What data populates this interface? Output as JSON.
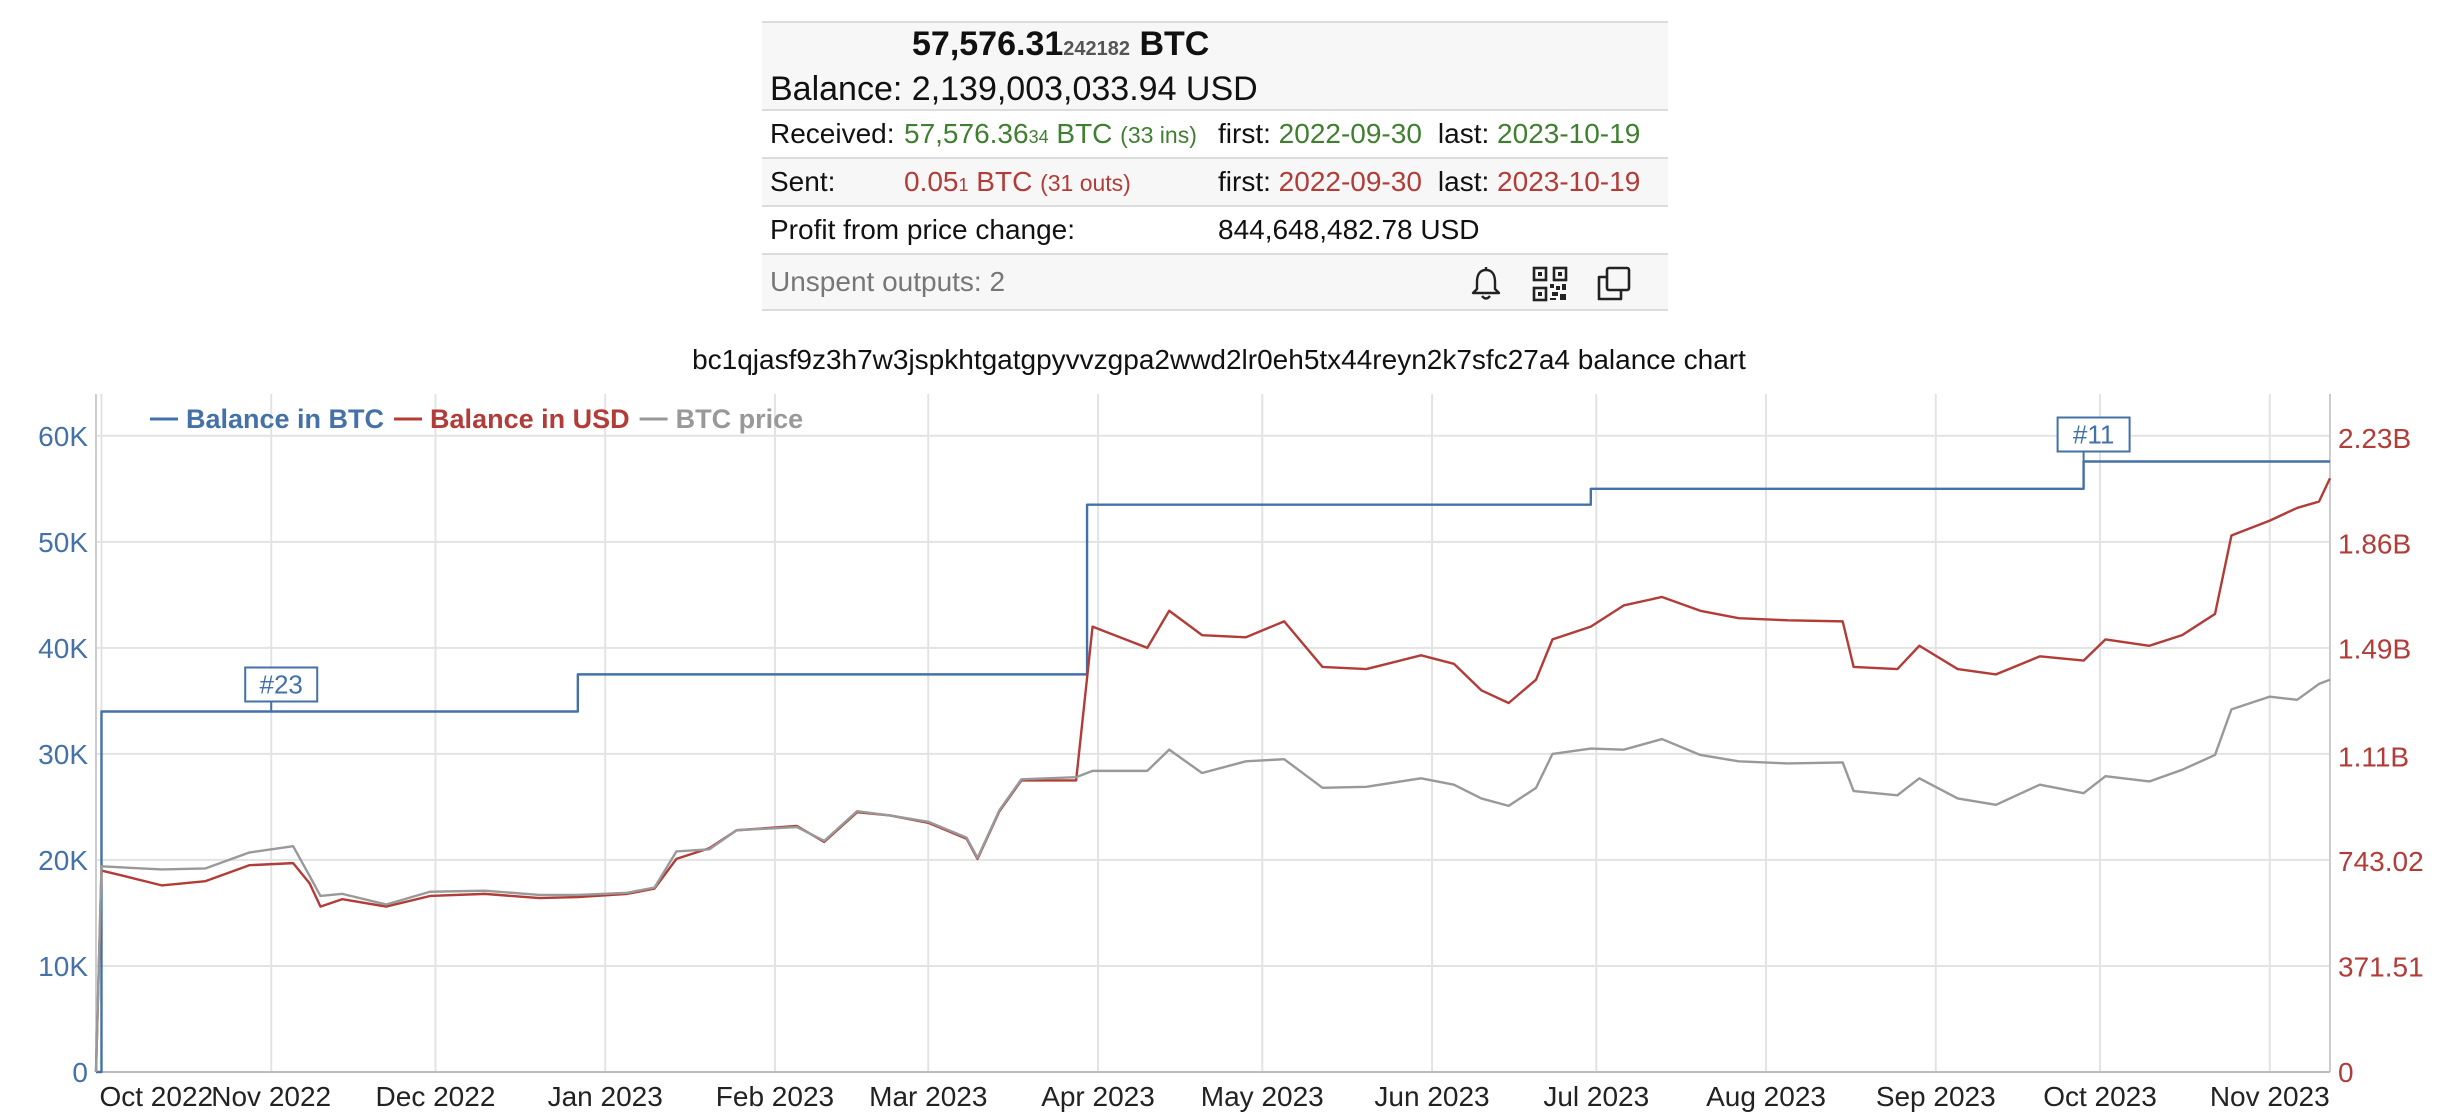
{
  "summary": {
    "btc_int": "57,576.31",
    "btc_frac": "242182",
    "btc_unit": "BTC",
    "balance_label": "Balance:",
    "balance_usd": "2,139,003,033.94 USD",
    "received": {
      "label": "Received:",
      "amount_main": "57,576.36",
      "amount_frac": "34",
      "unit": " BTC",
      "count": "(33 ins)",
      "first_label": "first:",
      "first": "2022-09-30",
      "last_label": "last:",
      "last": "2023-10-19"
    },
    "sent": {
      "label": "Sent:",
      "amount_main": "0.05",
      "amount_frac": "1",
      "unit": " BTC",
      "count": "(31 outs)",
      "first_label": "first:",
      "first": "2022-09-30",
      "last_label": "last:",
      "last": "2023-10-19"
    },
    "profit": {
      "label": "Profit from price change:",
      "value": "844,648,482.78 USD"
    },
    "unspent": "Unspent outputs: 2",
    "icons": [
      "bell-icon",
      "qr-code-icon",
      "copy-icon"
    ]
  },
  "chart_title": "bc1qjasf9z3h7w3jspkhtgatgpyvvzgpa2wwd2lr0eh5tx44reyn2k7sfc27a4 balance chart",
  "colors": {
    "btc": "#4471a8",
    "usd": "#b23c37",
    "price": "#999999",
    "grid": "#e3e3e3"
  },
  "chart_data": {
    "type": "line",
    "x_range": [
      "2022-09-30",
      "2023-11-12"
    ],
    "y_left": {
      "range": [
        0,
        63000
      ],
      "ticks": [
        0,
        10000,
        20000,
        30000,
        40000,
        50000,
        60000
      ],
      "tick_labels": [
        "0",
        "10K",
        "20K",
        "30K",
        "40K",
        "50K",
        "60K"
      ]
    },
    "y_right": {
      "range": [
        0,
        2350000000
      ],
      "ticks": [
        0,
        371510000,
        743020000,
        1110000000,
        1490000000,
        1860000000,
        2230000000
      ],
      "tick_labels": [
        "0",
        "371.51",
        "743.02",
        "1.11B",
        "1.49B",
        "1.86B",
        "2.23B"
      ]
    },
    "x_ticks": [
      "2022-10-01",
      "2022-11-01",
      "2022-12-01",
      "2023-01-01",
      "2023-02-01",
      "2023-03-01",
      "2023-04-01",
      "2023-05-01",
      "2023-06-01",
      "2023-07-01",
      "2023-08-01",
      "2023-09-01",
      "2023-10-01",
      "2023-11-01"
    ],
    "x_tick_labels": [
      "Oct 2022",
      "Nov 2022",
      "Dec 2022",
      "Jan 2023",
      "Feb 2023",
      "Mar 2023",
      "Apr 2023",
      "May 2023",
      "Jun 2023",
      "Jul 2023",
      "Aug 2023",
      "Sep 2023",
      "Oct 2023",
      "Nov 2023"
    ],
    "legend": [
      "Balance in BTC",
      "Balance in USD",
      "BTC price"
    ],
    "legend_position": "top-left",
    "grid": true,
    "series": [
      {
        "name": "Balance in BTC",
        "axis": "left",
        "step": true,
        "points": [
          [
            "2022-09-30",
            0
          ],
          [
            "2022-10-01",
            34000
          ],
          [
            "2022-12-27",
            37500
          ],
          [
            "2023-03-30",
            53500
          ],
          [
            "2023-06-30",
            55000
          ],
          [
            "2023-09-28",
            57576.31
          ],
          [
            "2023-11-12",
            57576.31
          ]
        ]
      },
      {
        "name": "Balance in USD",
        "axis": "left",
        "points": [
          [
            "2022-09-30",
            0
          ],
          [
            "2022-10-01",
            19000
          ],
          [
            "2022-10-05",
            18500
          ],
          [
            "2022-10-12",
            17600
          ],
          [
            "2022-10-20",
            18000
          ],
          [
            "2022-10-28",
            19500
          ],
          [
            "2022-11-05",
            19700
          ],
          [
            "2022-11-08",
            17800
          ],
          [
            "2022-11-10",
            15600
          ],
          [
            "2022-11-14",
            16300
          ],
          [
            "2022-11-22",
            15600
          ],
          [
            "2022-11-30",
            16600
          ],
          [
            "2022-12-10",
            16800
          ],
          [
            "2022-12-20",
            16400
          ],
          [
            "2022-12-27",
            16500
          ],
          [
            "2023-01-05",
            16800
          ],
          [
            "2023-01-10",
            17300
          ],
          [
            "2023-01-14",
            20100
          ],
          [
            "2023-01-20",
            21100
          ],
          [
            "2023-01-25",
            22800
          ],
          [
            "2023-02-05",
            23200
          ],
          [
            "2023-02-10",
            21700
          ],
          [
            "2023-02-16",
            24500
          ],
          [
            "2023-02-22",
            24200
          ],
          [
            "2023-03-01",
            23500
          ],
          [
            "2023-03-08",
            22000
          ],
          [
            "2023-03-10",
            20100
          ],
          [
            "2023-03-14",
            24600
          ],
          [
            "2023-03-18",
            27500
          ],
          [
            "2023-03-28",
            27500
          ],
          [
            "2023-03-31",
            42000
          ],
          [
            "2023-04-10",
            40000
          ],
          [
            "2023-04-14",
            43500
          ],
          [
            "2023-04-20",
            41200
          ],
          [
            "2023-04-28",
            41000
          ],
          [
            "2023-05-05",
            42500
          ],
          [
            "2023-05-12",
            38200
          ],
          [
            "2023-05-20",
            38000
          ],
          [
            "2023-05-30",
            39300
          ],
          [
            "2023-06-05",
            38500
          ],
          [
            "2023-06-10",
            36000
          ],
          [
            "2023-06-15",
            34800
          ],
          [
            "2023-06-20",
            37000
          ],
          [
            "2023-06-23",
            40800
          ],
          [
            "2023-06-30",
            42000
          ],
          [
            "2023-07-06",
            44000
          ],
          [
            "2023-07-13",
            44800
          ],
          [
            "2023-07-20",
            43500
          ],
          [
            "2023-07-27",
            42800
          ],
          [
            "2023-08-05",
            42600
          ],
          [
            "2023-08-15",
            42500
          ],
          [
            "2023-08-17",
            38200
          ],
          [
            "2023-08-25",
            38000
          ],
          [
            "2023-08-29",
            40200
          ],
          [
            "2023-09-05",
            38000
          ],
          [
            "2023-09-12",
            37500
          ],
          [
            "2023-09-20",
            39200
          ],
          [
            "2023-09-28",
            38800
          ],
          [
            "2023-10-02",
            40800
          ],
          [
            "2023-10-10",
            40200
          ],
          [
            "2023-10-16",
            41200
          ],
          [
            "2023-10-22",
            43200
          ],
          [
            "2023-10-25",
            50600
          ],
          [
            "2023-11-01",
            52000
          ],
          [
            "2023-11-06",
            53200
          ],
          [
            "2023-11-10",
            53800
          ],
          [
            "2023-11-12",
            56000
          ]
        ]
      },
      {
        "name": "BTC price",
        "axis": "left",
        "points": [
          [
            "2022-09-30",
            0
          ],
          [
            "2022-10-01",
            19400
          ],
          [
            "2022-10-12",
            19100
          ],
          [
            "2022-10-20",
            19200
          ],
          [
            "2022-10-28",
            20700
          ],
          [
            "2022-11-05",
            21300
          ],
          [
            "2022-11-08",
            18500
          ],
          [
            "2022-11-10",
            16600
          ],
          [
            "2022-11-14",
            16800
          ],
          [
            "2022-11-22",
            15800
          ],
          [
            "2022-11-30",
            17000
          ],
          [
            "2022-12-10",
            17100
          ],
          [
            "2022-12-20",
            16700
          ],
          [
            "2022-12-27",
            16700
          ],
          [
            "2023-01-05",
            16900
          ],
          [
            "2023-01-10",
            17400
          ],
          [
            "2023-01-14",
            20800
          ],
          [
            "2023-01-20",
            21000
          ],
          [
            "2023-01-25",
            22800
          ],
          [
            "2023-02-05",
            23100
          ],
          [
            "2023-02-10",
            21800
          ],
          [
            "2023-02-16",
            24600
          ],
          [
            "2023-02-22",
            24200
          ],
          [
            "2023-03-01",
            23600
          ],
          [
            "2023-03-08",
            22100
          ],
          [
            "2023-03-10",
            20200
          ],
          [
            "2023-03-14",
            24700
          ],
          [
            "2023-03-18",
            27600
          ],
          [
            "2023-03-28",
            27800
          ],
          [
            "2023-03-31",
            28400
          ],
          [
            "2023-04-10",
            28400
          ],
          [
            "2023-04-14",
            30400
          ],
          [
            "2023-04-20",
            28200
          ],
          [
            "2023-04-28",
            29300
          ],
          [
            "2023-05-05",
            29500
          ],
          [
            "2023-05-12",
            26800
          ],
          [
            "2023-05-20",
            26900
          ],
          [
            "2023-05-30",
            27700
          ],
          [
            "2023-06-05",
            27100
          ],
          [
            "2023-06-10",
            25800
          ],
          [
            "2023-06-15",
            25100
          ],
          [
            "2023-06-20",
            26800
          ],
          [
            "2023-06-23",
            30000
          ],
          [
            "2023-06-30",
            30500
          ],
          [
            "2023-07-06",
            30400
          ],
          [
            "2023-07-13",
            31400
          ],
          [
            "2023-07-20",
            29900
          ],
          [
            "2023-07-27",
            29300
          ],
          [
            "2023-08-05",
            29100
          ],
          [
            "2023-08-15",
            29200
          ],
          [
            "2023-08-17",
            26500
          ],
          [
            "2023-08-25",
            26100
          ],
          [
            "2023-08-29",
            27700
          ],
          [
            "2023-09-05",
            25800
          ],
          [
            "2023-09-12",
            25200
          ],
          [
            "2023-09-20",
            27100
          ],
          [
            "2023-09-28",
            26300
          ],
          [
            "2023-10-02",
            27900
          ],
          [
            "2023-10-10",
            27400
          ],
          [
            "2023-10-16",
            28500
          ],
          [
            "2023-10-22",
            29900
          ],
          [
            "2023-10-25",
            34200
          ],
          [
            "2023-11-01",
            35400
          ],
          [
            "2023-11-06",
            35100
          ],
          [
            "2023-11-10",
            36600
          ],
          [
            "2023-11-12",
            37000
          ]
        ]
      }
    ],
    "annotations": [
      {
        "label": "#23",
        "x": "2022-11-01",
        "y": 34000
      },
      {
        "label": "#11",
        "x": "2023-09-28",
        "y": 57576.31
      }
    ]
  }
}
